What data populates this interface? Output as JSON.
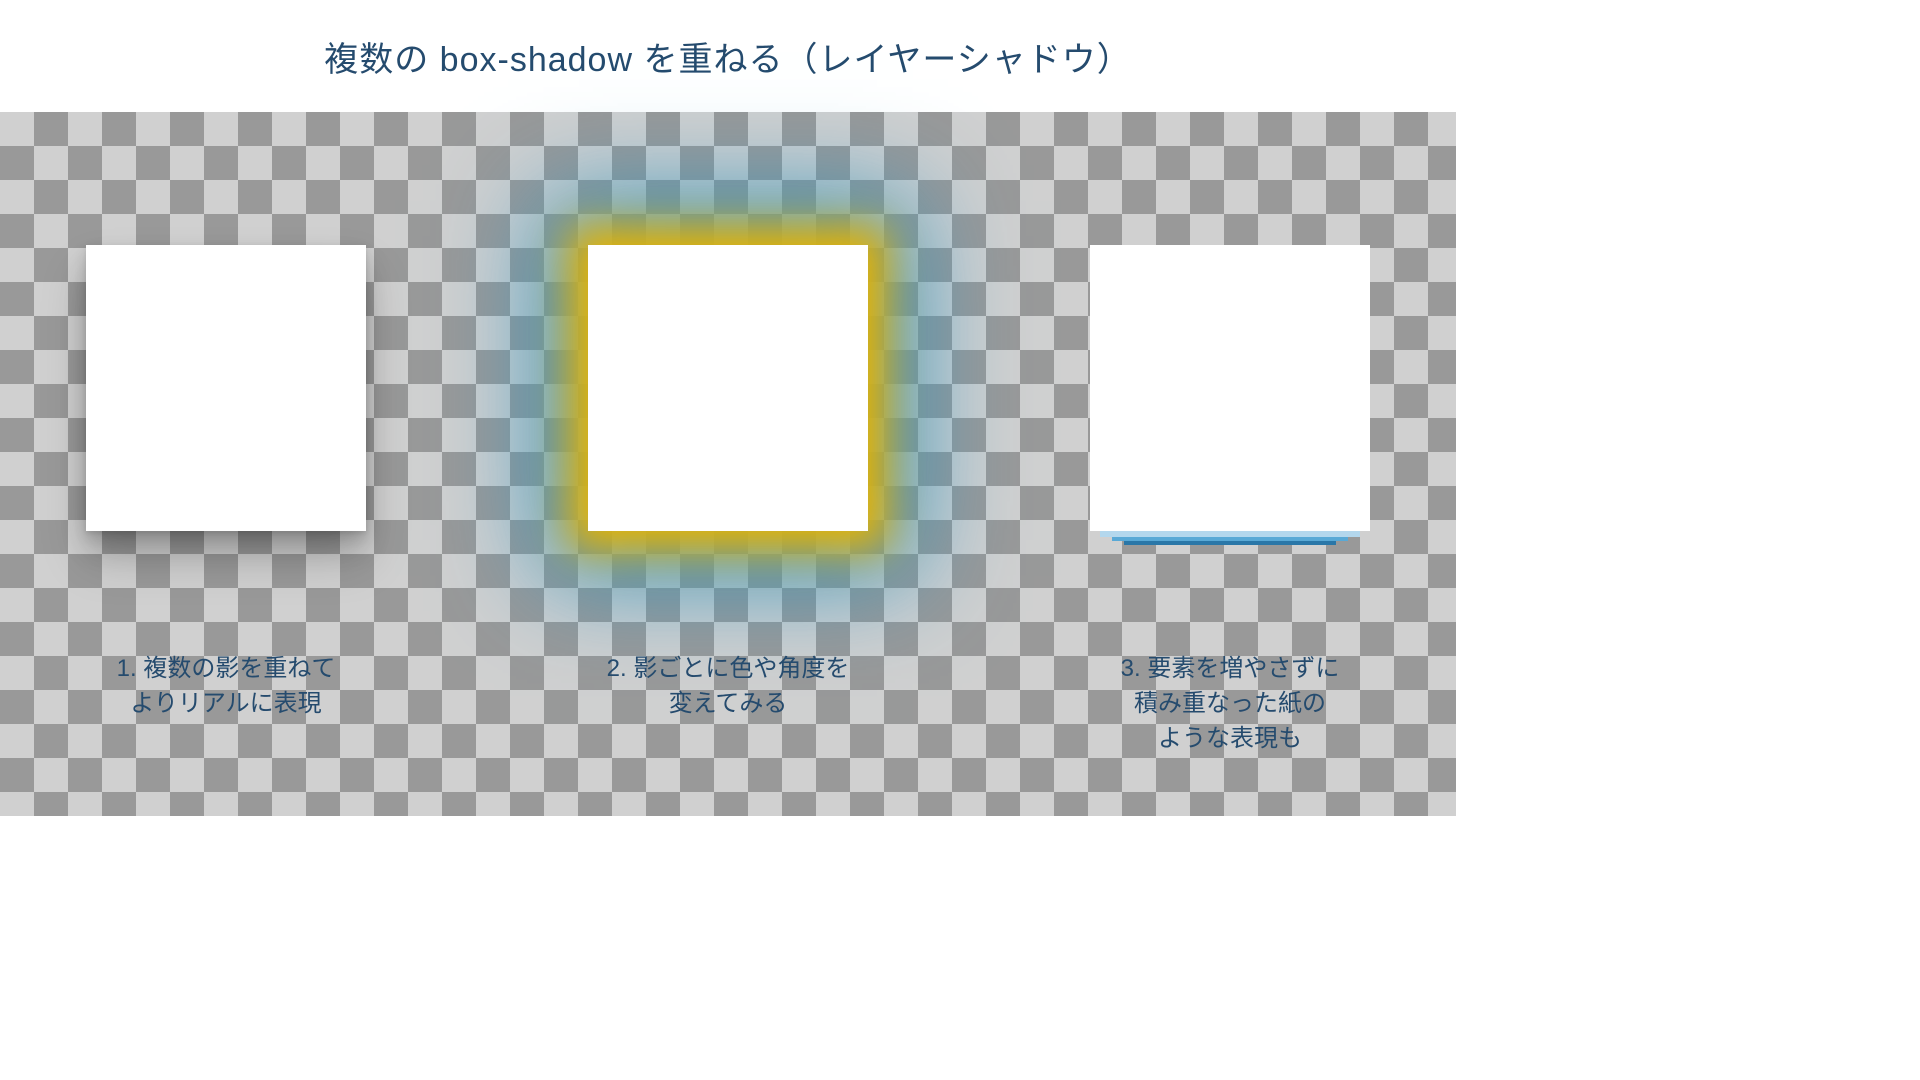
{
  "title": "複数の box-shadow を重ねる（レイヤーシャドウ）",
  "examples": {
    "ex1": {
      "caption_line1": "1. 複数の影を重ねて",
      "caption_line2": "よりリアルに表現"
    },
    "ex2": {
      "caption_line1": "2. 影ごとに色や角度を",
      "caption_line2": "変えてみる"
    },
    "ex3": {
      "caption_line1": "3. 要素を増やさずに",
      "caption_line2": "積み重なった紙の",
      "caption_line3": "ような表現も"
    }
  }
}
